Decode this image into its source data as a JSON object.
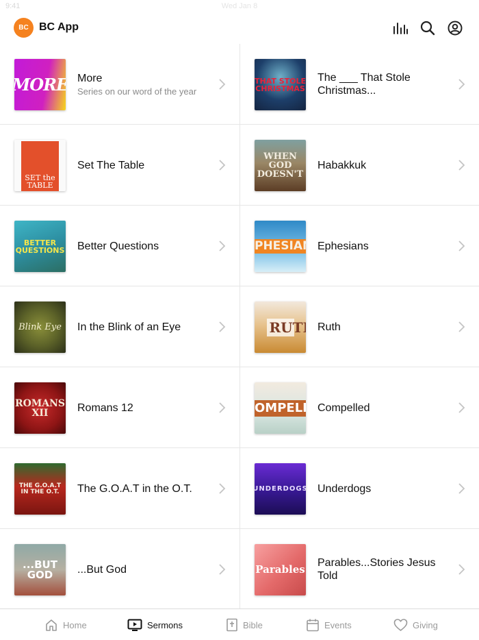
{
  "status": {
    "time": "9:41",
    "date": "Wed Jan 8"
  },
  "header": {
    "logo_text": "BC",
    "title": "BC App",
    "icons": [
      "audio-bars-icon",
      "search-icon",
      "account-icon"
    ],
    "accent": "#f5821f"
  },
  "series": [
    {
      "title": "More",
      "subtitle": "Series on our word of the year",
      "art": "MORE"
    },
    {
      "title": "The ___ That Stole Christmas...",
      "subtitle": "",
      "art": "THAT STOLE CHRISTMAS"
    },
    {
      "title": "Set The Table",
      "subtitle": "",
      "art": "SET the TABLE"
    },
    {
      "title": "Habakkuk",
      "subtitle": "",
      "art": "WHEN GOD DOESN'T"
    },
    {
      "title": "Better Questions",
      "subtitle": "",
      "art": "BETTER QUESTIONS"
    },
    {
      "title": "Ephesians",
      "subtitle": "",
      "art": "PHESIAN"
    },
    {
      "title": "In the Blink of an Eye",
      "subtitle": "",
      "art": "Blink Eye"
    },
    {
      "title": "Ruth",
      "subtitle": "",
      "art": "RUTH"
    },
    {
      "title": "Romans 12",
      "subtitle": "",
      "art": "ROMANS XII"
    },
    {
      "title": "Compelled",
      "subtitle": "",
      "art": "OMPELLE"
    },
    {
      "title": "The G.O.A.T in the O.T.",
      "subtitle": "",
      "art": "THE G.O.A.T IN THE O.T."
    },
    {
      "title": "Underdogs",
      "subtitle": "",
      "art": "UNDERDOGS"
    },
    {
      "title": "...But God",
      "subtitle": "",
      "art": "...BUT GOD"
    },
    {
      "title": "Parables...Stories Jesus Told",
      "subtitle": "",
      "art": "Parables"
    }
  ],
  "tabs": [
    {
      "label": "Home",
      "icon": "home-icon",
      "active": false
    },
    {
      "label": "Sermons",
      "icon": "tv-icon",
      "active": true
    },
    {
      "label": "Bible",
      "icon": "bible-icon",
      "active": false
    },
    {
      "label": "Events",
      "icon": "calendar-icon",
      "active": false
    },
    {
      "label": "Giving",
      "icon": "heart-icon",
      "active": false
    }
  ]
}
